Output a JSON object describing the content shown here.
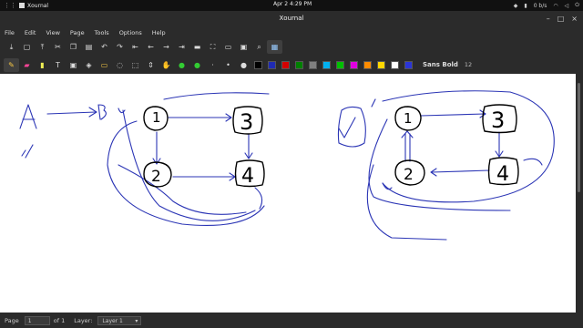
{
  "topbar": {
    "activity": "Xournal",
    "clock": "Apr 2   4:29 PM",
    "net": "0 b/s"
  },
  "window": {
    "title": "Xournal"
  },
  "menu": [
    "File",
    "Edit",
    "View",
    "Page",
    "Tools",
    "Options",
    "Help"
  ],
  "toolbar": {
    "icons_row1": [
      "save-icon",
      "new-page-icon",
      "export-icon",
      "cut-icon",
      "copy-icon",
      "paste-icon",
      "undo-icon",
      "redo-icon",
      "first-page-icon",
      "prev-page-icon",
      "next-page-icon",
      "last-page-icon",
      "zoom-out-icon",
      "zoom-fit-icon",
      "zoom-in-icon",
      "search-icon",
      "fullscreen-icon"
    ],
    "icons_row2": [
      "pen-icon",
      "eraser-icon",
      "highlighter-icon",
      "text-icon",
      "image-icon",
      "shape-icon",
      "ruler-icon",
      "lasso-icon",
      "rect-select-icon",
      "hand-icon",
      "color-picker-icon",
      "default-pen-icon",
      "thin-icon",
      "medium-icon"
    ],
    "colors": [
      "#000000",
      "#1f2bb3",
      "#d40000",
      "#008000",
      "#808080",
      "#00b0f0",
      "#00c000",
      "#e000e0",
      "#ff8c00",
      "#ffd700",
      "#ffffff",
      "#2b35d6"
    ],
    "font_name": "Sans Bold",
    "font_size": "12"
  },
  "canvas": {
    "nodes_left": [
      "1",
      "3",
      "2",
      "4"
    ],
    "nodes_right": [
      "1",
      "3",
      "2",
      "4"
    ],
    "labels": {
      "a": "A",
      "b": "B"
    }
  },
  "status": {
    "page_label": "Page",
    "page_value": "1",
    "page_of": "of 1",
    "layer_label": "Layer:",
    "layer_value": "Layer 1"
  }
}
